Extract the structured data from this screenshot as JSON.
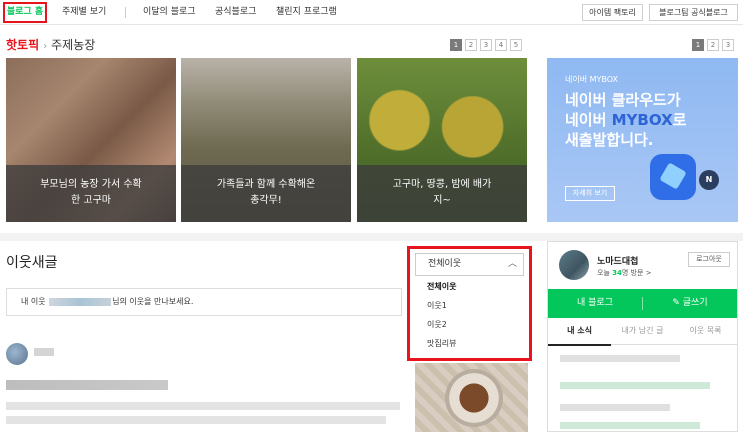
{
  "nav": {
    "home": "블로그 홈",
    "items": [
      "주제별 보기",
      "이달의 블로그",
      "공식블로그",
      "챌린지 프로그램"
    ],
    "buttons": [
      "아이템 팩토리",
      "블로그팀 공식블로그"
    ]
  },
  "hot_topic": {
    "label": "핫토픽",
    "category": "주제농장",
    "pages": [
      "1",
      "2",
      "3",
      "4",
      "5"
    ],
    "cards": [
      {
        "caption_l1": "부모님의 농장 가서 수확",
        "caption_l2": "한 고구마"
      },
      {
        "caption_l1": "가족들과 함께 수확해온",
        "caption_l2": "총각무!"
      },
      {
        "caption_l1": "고구마, 땅콩, 밤에 배가",
        "caption_l2": "지~"
      }
    ]
  },
  "ad": {
    "pages": [
      "1",
      "2",
      "3"
    ],
    "brand": "네이버 MYBOX",
    "line1": "네이버 클라우드가",
    "line2_pre": "네이버 ",
    "line2_hi": "MYBOX",
    "line2_post": "로",
    "line3": "새출발합니다.",
    "more": "자세히 보기",
    "n_badge": "N"
  },
  "neighbors": {
    "title": "이웃새글",
    "notice_prefix": "내 이웃 ",
    "notice_suffix": "님의 이웃을 만나보세요.",
    "dropdown": {
      "selected": "전체이웃",
      "options": [
        "전체이웃",
        "이웃1",
        "이웃2",
        "맛집리뷰"
      ]
    }
  },
  "profile": {
    "name": "노마드대첩",
    "visits_prefix": "오늘 ",
    "visits_count": "34",
    "visits_suffix": "명 방문 >",
    "logout": "로그아웃",
    "my_blog": "내 블로그",
    "write": "✎ 글쓰기",
    "tabs": [
      "내 소식",
      "내가 남긴 글",
      "이웃 목록"
    ]
  }
}
